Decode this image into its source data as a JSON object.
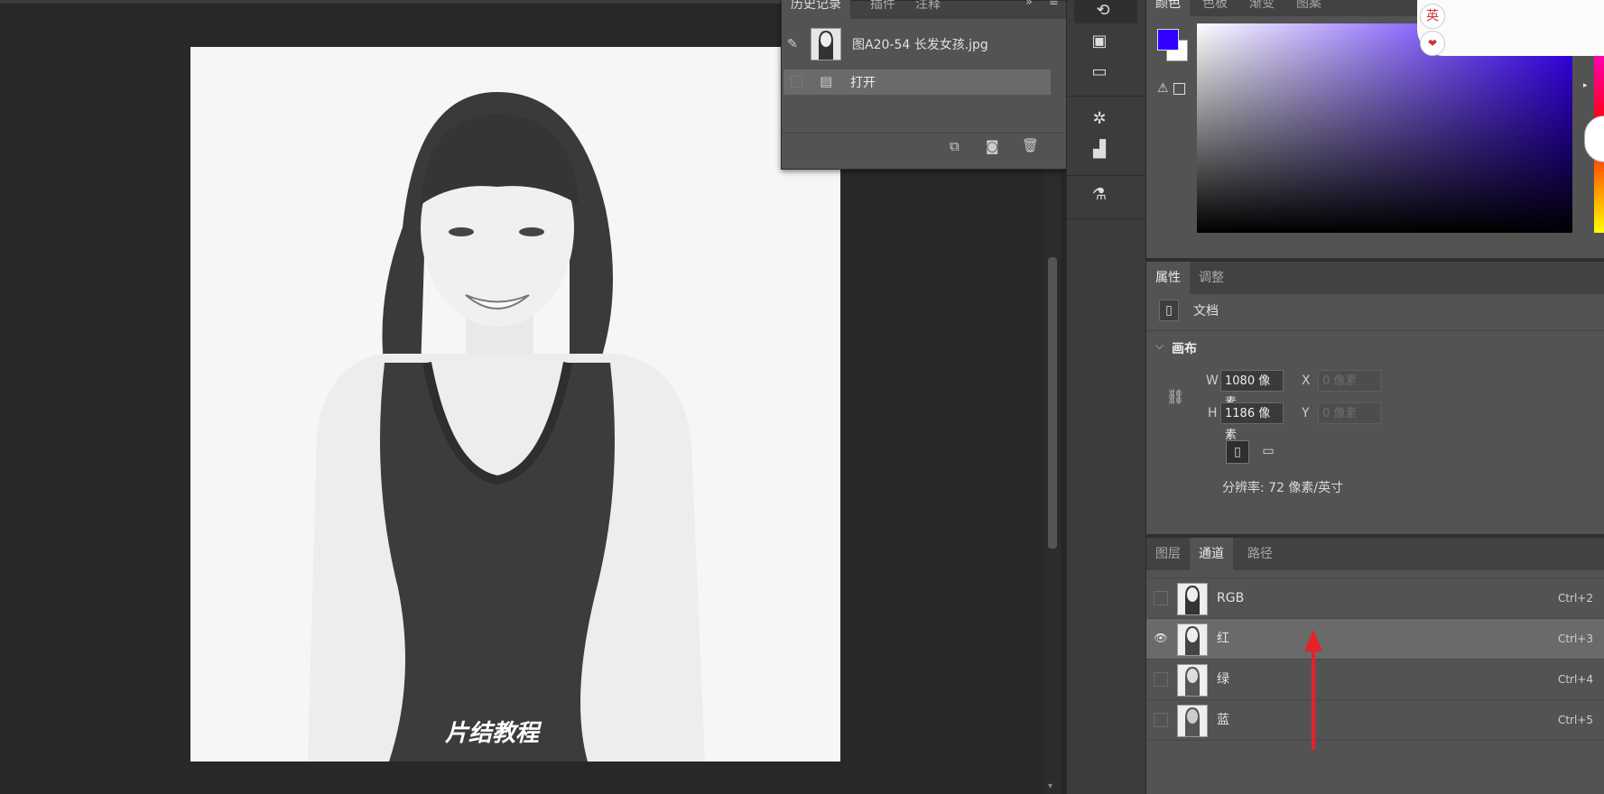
{
  "history_panel": {
    "tabs": [
      "历史记录",
      "插件",
      "注释"
    ],
    "snapshot_name": "图A20-54 长发女孩.jpg",
    "steps": [
      {
        "label": "打开"
      }
    ]
  },
  "canvas": {
    "watermark": "片结教程"
  },
  "color_panel": {
    "tabs": [
      "颜色",
      "色板",
      "渐变",
      "图案"
    ],
    "foreground": "#3300ff",
    "background": "#ffffff"
  },
  "properties_panel": {
    "tabs": [
      "属性",
      "调整"
    ],
    "doc_label": "文档",
    "section_title": "画布",
    "width_label": "W",
    "width_value": "1080 像素",
    "height_label": "H",
    "height_value": "1186 像素",
    "x_label": "X",
    "x_placeholder": "0 像素",
    "y_label": "Y",
    "y_placeholder": "0 像素",
    "resolution": "分辨率: 72 像素/英寸"
  },
  "channels_panel": {
    "tabs": [
      "图层",
      "通道",
      "路径"
    ],
    "channels": [
      {
        "name": "RGB",
        "shortcut": "Ctrl+2",
        "visible": false,
        "selected": false
      },
      {
        "name": "红",
        "shortcut": "Ctrl+3",
        "visible": true,
        "selected": true
      },
      {
        "name": "绿",
        "shortcut": "Ctrl+4",
        "visible": false,
        "selected": false
      },
      {
        "name": "蓝",
        "shortcut": "Ctrl+5",
        "visible": false,
        "selected": false
      }
    ]
  },
  "ime_badge": "英",
  "annotation": {
    "arrow_color": "#e8202a"
  }
}
